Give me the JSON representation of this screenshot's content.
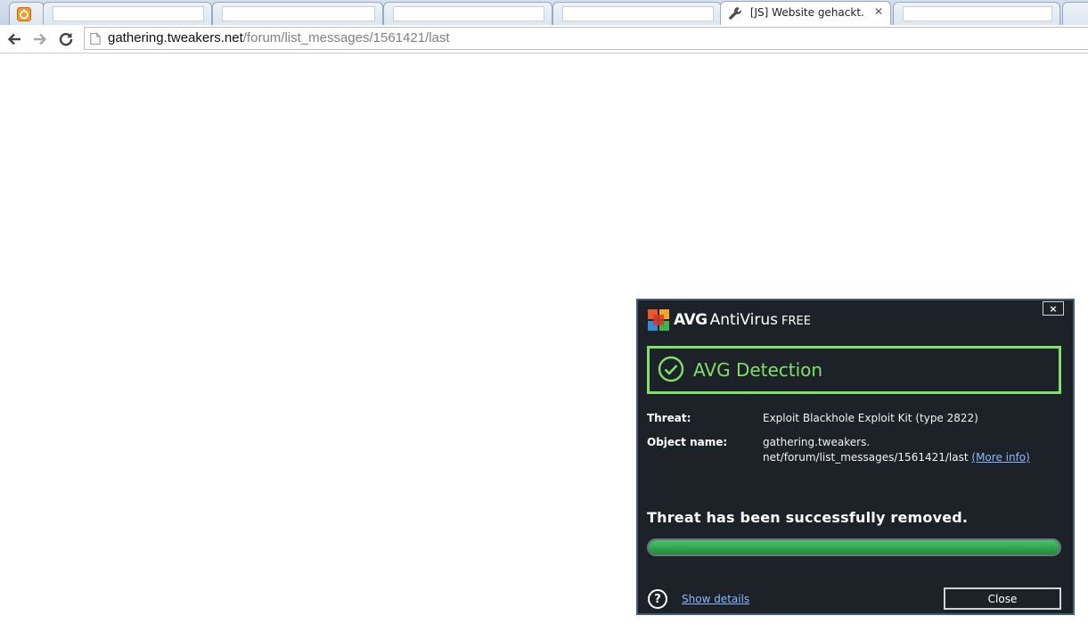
{
  "browser": {
    "tabs": [
      {
        "title": ""
      },
      {
        "title": ""
      },
      {
        "title": ""
      },
      {
        "title": ""
      },
      {
        "title": ""
      },
      {
        "title": "[JS] Website gehackt. Wat",
        "active": true
      },
      {
        "title": ""
      },
      {
        "title": ""
      }
    ],
    "address": {
      "host": "gathering.tweakers.net",
      "path": "/forum/list_messages/1561421/last"
    }
  },
  "avg": {
    "brand_main": "AVG",
    "brand_product": "AntiVirus",
    "brand_edition": "FREE",
    "close_x": "×",
    "detection_title": "AVG Detection",
    "threat_label": "Threat:",
    "threat_value": "Exploit Blackhole Exploit Kit (type 2822)",
    "object_label": "Object name:",
    "object_line1": "gathering.tweakers.",
    "object_line2": "net/forum/list_messages/1561421/last",
    "more_info": "(More info)",
    "status": "Threat has been successfully removed.",
    "progress": 1.0,
    "help": "?",
    "show_details": "Show details",
    "close_button": "Close",
    "colors": {
      "accent_green": "#7fe06a",
      "panel_bg": "#1d2229",
      "link": "#8ab7ff"
    }
  }
}
